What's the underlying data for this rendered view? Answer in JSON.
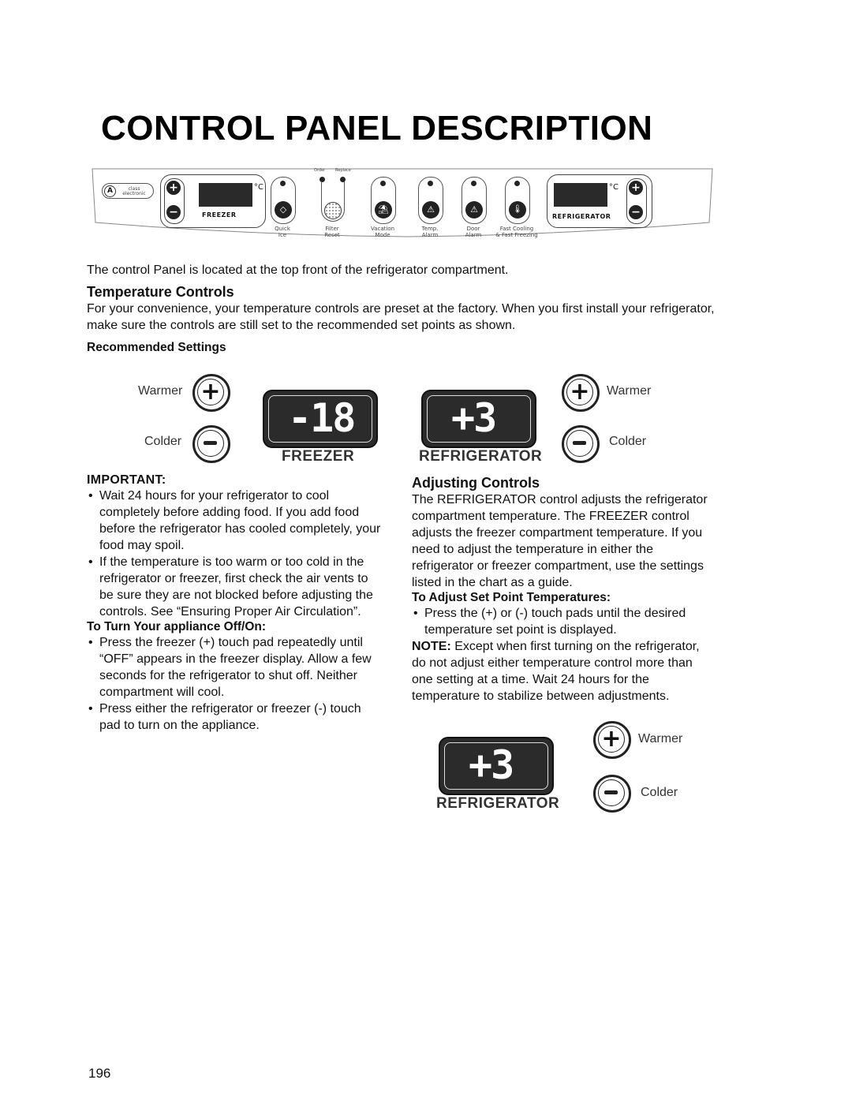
{
  "page": {
    "title": "CONTROL PANEL DESCRIPTION",
    "page_number": "196"
  },
  "panel": {
    "brand": "class electronic",
    "brand_icon": "a-logo-icon",
    "freezer_label": "FREEZER",
    "refrigerator_label": "REFRIGERATOR",
    "degree_unit": "°C",
    "filter_order": "Order",
    "filter_replace": "Replace",
    "buttons": [
      {
        "line1": "Quick",
        "line2": "Ice",
        "icon": "ice-cube-icon"
      },
      {
        "line1": "Filter",
        "line2": "Reset",
        "icon": "filter-icon"
      },
      {
        "line1": "Vacation",
        "line2": "Mode",
        "icon": "vacation-icon"
      },
      {
        "line1": "Temp.",
        "line2": "Alarm",
        "icon": "warning-icon"
      },
      {
        "line1": "Door",
        "line2": "Alarm",
        "icon": "warning-icon"
      },
      {
        "line1": "Fast Cooling",
        "line2": "& Fast Freezing",
        "icon": "thermometer-icon"
      }
    ]
  },
  "intro": "The control Panel is located at the top front of the refrigerator compartment.",
  "temperature_controls": {
    "heading": "Temperature Controls",
    "text": "For your convenience, your temperature controls are preset at the factory. When you first install your refrigerator, make sure the controls are still set to the recommended set points as shown.",
    "recommended_heading": "Recommended Settings"
  },
  "freezer_setting": {
    "warmer": "Warmer",
    "colder": "Colder",
    "display": "-18",
    "label": "FREEZER"
  },
  "refrigerator_setting": {
    "warmer": "Warmer",
    "colder": "Colder",
    "display": "+3",
    "label": "REFRIGERATOR"
  },
  "important": {
    "heading": "IMPORTANT:",
    "bullets": [
      "Wait 24 hours for your refrigerator to cool completely before adding food. If you add food before the refrigerator has cooled completely, your food may spoil.",
      "If the temperature is too warm or too cold in the refrigerator or freezer, first check the air vents to be sure they are not blocked before adjusting the controls. See “Ensuring Proper Air Circulation”."
    ],
    "off_on_heading": "To Turn Your appliance Off/On:",
    "off_on_bullets": [
      "Press the freezer (+) touch pad repeatedly until “OFF” appears in the freezer display. Allow a few seconds for the refrigerator to shut off. Neither compartment will cool.",
      "Press either the refrigerator or freezer (-) touch pad to turn on the appliance."
    ]
  },
  "adjusting": {
    "heading": "Adjusting Controls",
    "text": "The REFRIGERATOR control adjusts the refrigerator compartment temperature. The FREEZER control adjusts the freezer compartment temperature. If you need to adjust the temperature in either the refrigerator or freezer compartment, use the settings listed in the chart as a guide.",
    "set_point_heading": "To Adjust Set Point Temperatures:",
    "set_point_bullets": [
      "Press the (+) or (-) touch pads until the desired temperature set point is displayed."
    ],
    "note_label": "NOTE:",
    "note_text": " Except when first turning on the refrigerator, do not adjust either temperature control more than one setting at a time. Wait 24 hours for the temperature to stabilize between adjustments."
  },
  "refrigerator_example": {
    "warmer": "Warmer",
    "colder": "Colder",
    "display": "+3",
    "label": "REFRIGERATOR"
  }
}
